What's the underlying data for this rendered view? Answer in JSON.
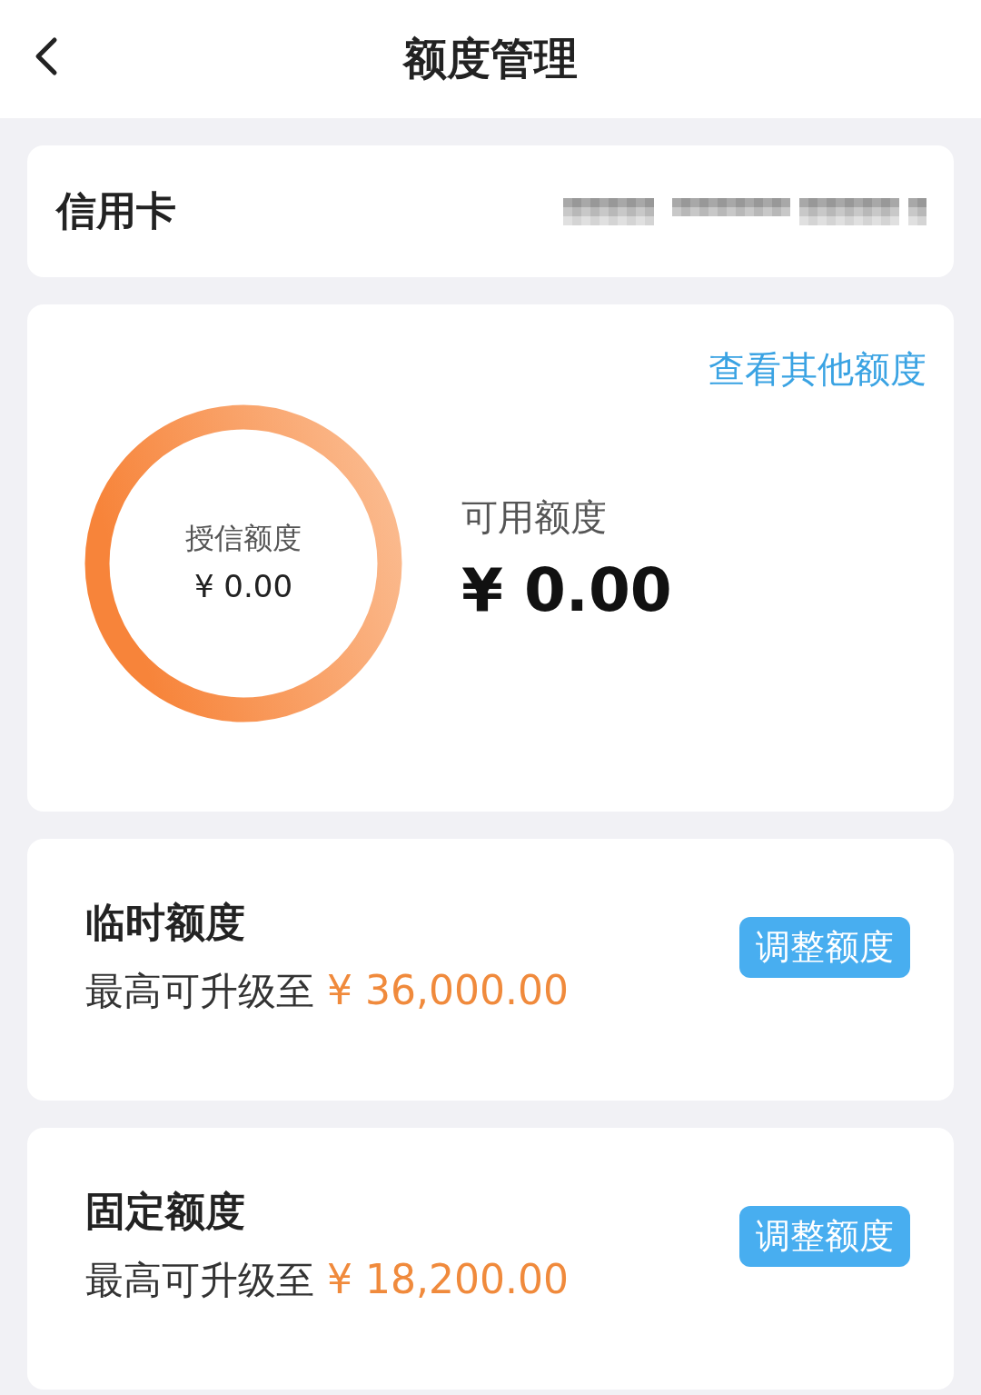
{
  "header": {
    "title": "额度管理"
  },
  "card": {
    "label": "信用卡"
  },
  "overview": {
    "link": "查看其他额度",
    "ring_label": "授信额度",
    "ring_amount": "¥ 0.00",
    "available_label": "可用额度",
    "available_amount": "¥ 0.00"
  },
  "limits": [
    {
      "title": "临时额度",
      "prefix": "最高可升级至",
      "amount": "¥ 36,000.00",
      "button": "调整额度"
    },
    {
      "title": "固定额度",
      "prefix": "最高可升级至",
      "amount": "¥ 18,200.00",
      "button": "调整额度"
    }
  ]
}
